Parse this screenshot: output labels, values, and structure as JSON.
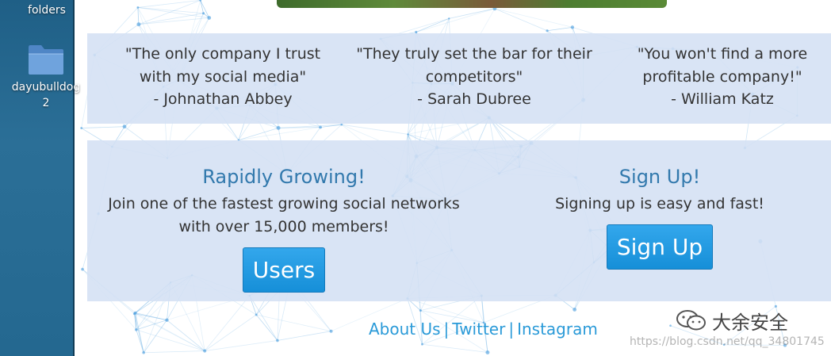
{
  "desktop": {
    "top_label": "folders",
    "folder_label": "dayubulldog 2",
    "folder_icon": "folder-icon"
  },
  "testimonials": [
    {
      "quote": "\"The only company I trust with my social media\"",
      "author": "- Johnathan Abbey"
    },
    {
      "quote": "\"They truly set the bar for their competitors\"",
      "author": "- Sarah Dubree"
    },
    {
      "quote": "\"You won't find a more profitable company!\"",
      "author": "- William Katz"
    }
  ],
  "features": {
    "growing": {
      "title": "Rapidly Growing!",
      "text": "Join one of the fastest growing social networks with over 15,000 members!",
      "button": "Users"
    },
    "signup": {
      "title": "Sign Up!",
      "text": "Signing up is easy and fast!",
      "button": "Sign Up"
    }
  },
  "footer": {
    "links": [
      "About Us",
      "Twitter",
      "Instagram"
    ],
    "separator": "|"
  },
  "watermark": {
    "brand": "大余安全",
    "url": "https://blog.csdn.net/qq_34801745",
    "icon": "wechat-icon"
  },
  "colors": {
    "panel": "#d4e0f4",
    "heading": "#3279ad",
    "button": "#2199e2",
    "link": "#2a9ad8",
    "desktop": "#246890"
  }
}
